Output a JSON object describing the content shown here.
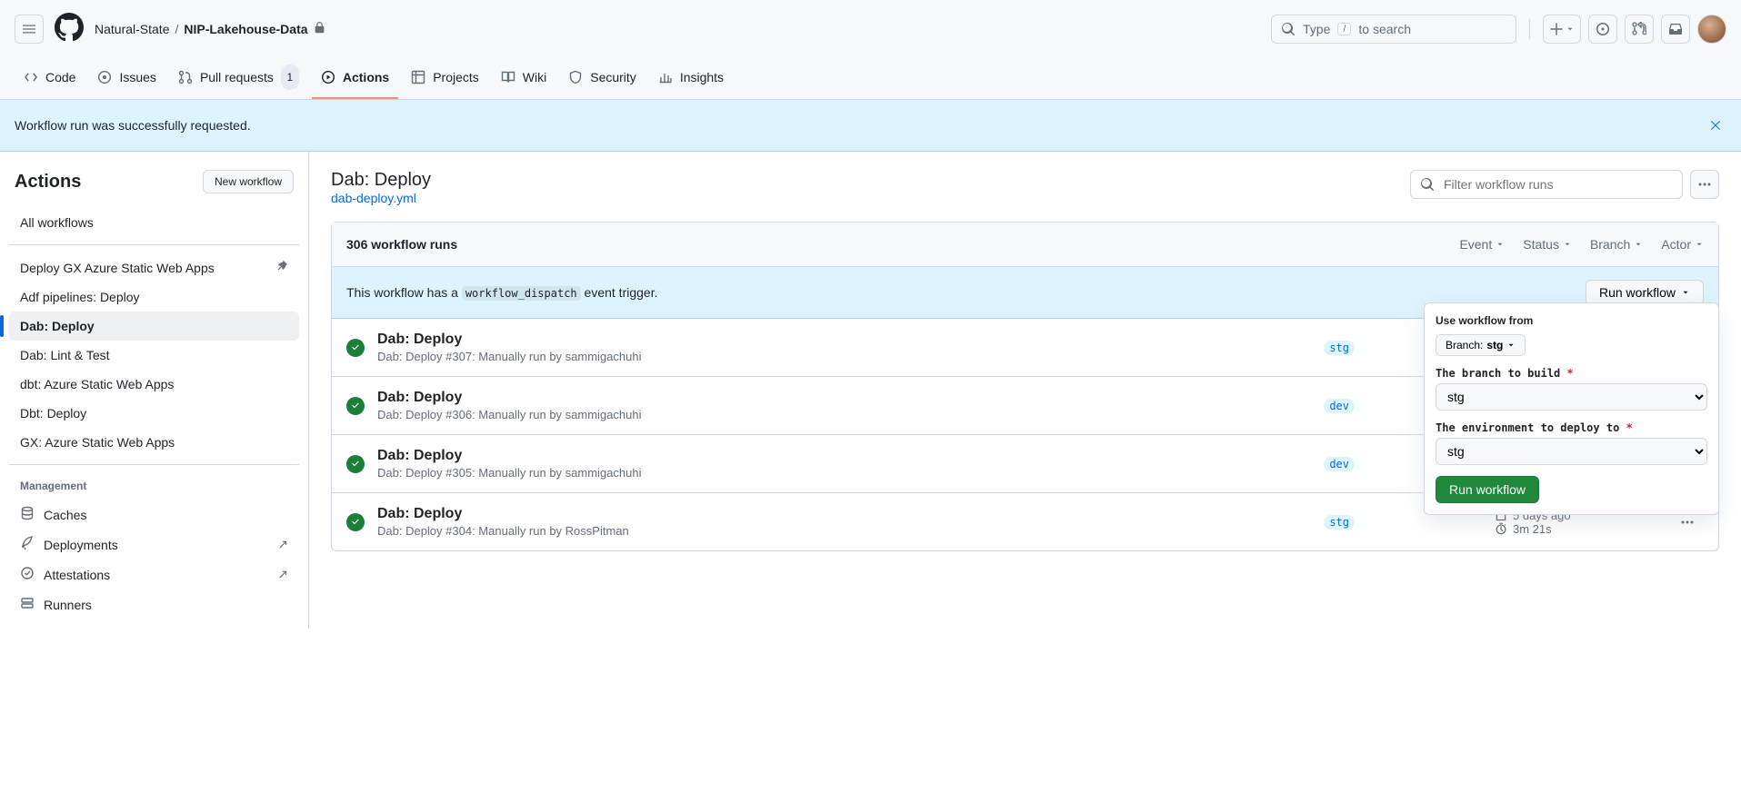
{
  "header": {
    "org": "Natural-State",
    "repo": "NIP-Lakehouse-Data",
    "search_placeholder": "Type",
    "search_placeholder_rest": "to search",
    "search_key": "/"
  },
  "tabs": {
    "code": "Code",
    "issues": "Issues",
    "pulls": "Pull requests",
    "pulls_count": "1",
    "actions": "Actions",
    "projects": "Projects",
    "wiki": "Wiki",
    "security": "Security",
    "insights": "Insights"
  },
  "flash": {
    "message": "Workflow run was successfully requested."
  },
  "sidebar": {
    "title": "Actions",
    "new_workflow": "New workflow",
    "all": "All workflows",
    "workflows": [
      "Deploy GX Azure Static Web Apps",
      "Adf pipelines: Deploy",
      "Dab: Deploy",
      "Dab: Lint & Test",
      "dbt: Azure Static Web Apps",
      "Dbt: Deploy",
      "GX: Azure Static Web Apps"
    ],
    "management_heading": "Management",
    "caches": "Caches",
    "deployments": "Deployments",
    "attestations": "Attestations",
    "runners": "Runners"
  },
  "main": {
    "title": "Dab: Deploy",
    "file": "dab-deploy.yml",
    "filter_placeholder": "Filter workflow runs",
    "runs_count": "306 workflow runs",
    "filters": {
      "event": "Event",
      "status": "Status",
      "branch": "Branch",
      "actor": "Actor"
    },
    "dispatch_pre": "This workflow has a ",
    "dispatch_code": "workflow_dispatch",
    "dispatch_post": " event trigger.",
    "run_wf_btn": "Run workflow",
    "runs": [
      {
        "title": "Dab: Deploy",
        "sub": "Dab: Deploy #307: Manually run by sammigachuhi",
        "branch": "stg",
        "time": "",
        "dur": ""
      },
      {
        "title": "Dab: Deploy",
        "sub": "Dab: Deploy #306: Manually run by sammigachuhi",
        "branch": "dev",
        "time": "",
        "dur": ""
      },
      {
        "title": "Dab: Deploy",
        "sub": "Dab: Deploy #305: Manually run by sammigachuhi",
        "branch": "dev",
        "time": "",
        "dur": ""
      },
      {
        "title": "Dab: Deploy",
        "sub": "Dab: Deploy #304: Manually run by RossPitman",
        "branch": "stg",
        "time": "5 days ago",
        "dur": "3m 21s"
      }
    ]
  },
  "popover": {
    "use_from": "Use workflow from",
    "branch_label_pre": "Branch: ",
    "branch_value": "stg",
    "branch_to_build": "The branch to build ",
    "branch_sel": "stg",
    "env_to_deploy": "The environment to deploy to ",
    "env_sel": "stg",
    "submit": "Run workflow"
  }
}
